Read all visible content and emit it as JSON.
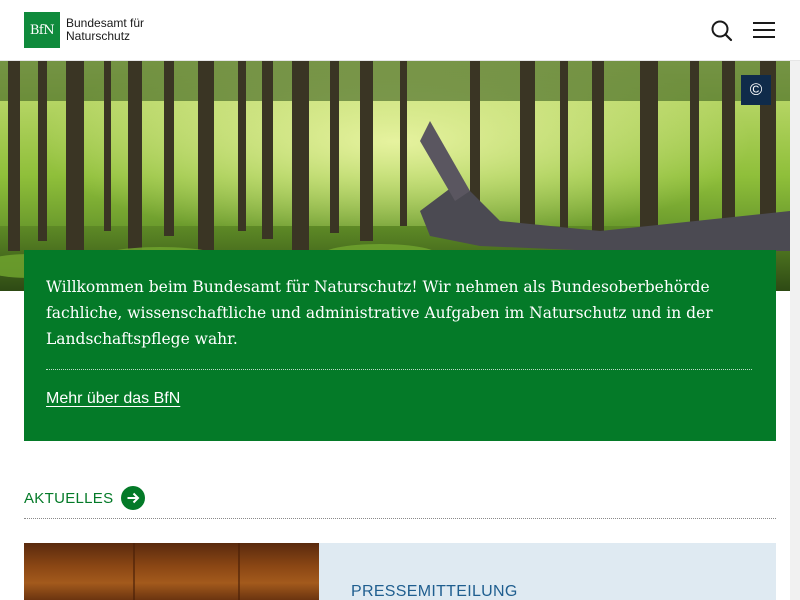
{
  "header": {
    "logo_mark": "BfN",
    "logo_line1": "Bundesamt für",
    "logo_line2": "Naturschutz",
    "search_icon": "search-icon",
    "menu_icon": "hamburger-menu-icon"
  },
  "hero": {
    "copyright_label": "©"
  },
  "intro": {
    "text": "Willkommen beim Bundesamt für Naturschutz! Wir nehmen als Bundesoberbehörde fachliche, wissenschaftliche und administrative Aufgaben im Naturschutz und in der Landschaftspflege wahr.",
    "link_label": "Mehr über das BfN"
  },
  "news": {
    "section_title": "AKTUELLES",
    "arrow_icon": "arrow-right-icon",
    "card_kicker": "PRESSEMITTEILUNG"
  },
  "colors": {
    "brand_green": "#047a28",
    "logo_green": "#0f8a3c",
    "copyright_bg": "#0f2b4a",
    "card_bg": "#dfeaf2",
    "kicker_blue": "#1f5e8f"
  }
}
